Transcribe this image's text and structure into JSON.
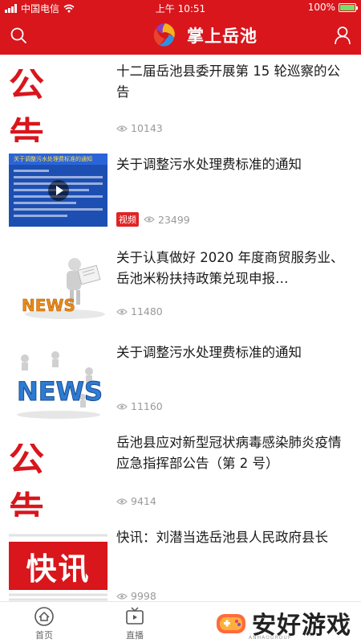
{
  "status_bar": {
    "carrier": "中国电信",
    "time": "上午 10:51",
    "battery": "100%"
  },
  "header": {
    "title": "掌上岳池"
  },
  "articles": [
    {
      "thumb_text": "公 告",
      "title": "十二届岳池县委开展第 15 轮巡察的公告",
      "views": "10143"
    },
    {
      "thumb_text": "关于调整污水处理费标准的通知",
      "title": "关于调整污水处理费标准的通知",
      "tag": "视频",
      "views": "23499"
    },
    {
      "thumb_text": "NEWS",
      "title": "关于认真做好 2020 年度商贸服务业、岳池米粉扶持政策兑现申报…",
      "views": "11480"
    },
    {
      "thumb_text": "NEWS",
      "title": "关于调整污水处理费标准的通知",
      "views": "11160"
    },
    {
      "thumb_text": "公 告",
      "title": "岳池县应对新型冠状病毒感染肺炎疫情 应急指挥部公告（第 2 号）",
      "views": "9414"
    },
    {
      "thumb_text": "快讯",
      "title": "快讯：刘潜当选岳池县人民政府县长",
      "views": "9998"
    }
  ],
  "tabs": [
    {
      "label": "首页",
      "icon": "home-icon"
    },
    {
      "label": "直播",
      "icon": "tv-icon"
    }
  ],
  "watermark": {
    "text": "安好游戏",
    "sub": "ANHAOGROUP"
  },
  "colors": {
    "brand_red": "#d8161c",
    "tag_red": "#e02424",
    "meta_gray": "#999999"
  }
}
